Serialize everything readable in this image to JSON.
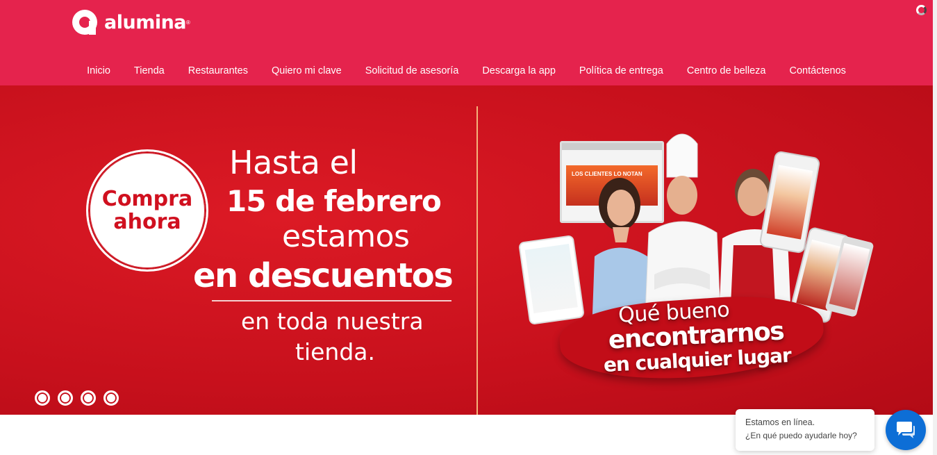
{
  "brand": {
    "name": "alumina",
    "mark": "®",
    "color": "#e5234d"
  },
  "nav": {
    "items": [
      {
        "label": "Inicio"
      },
      {
        "label": "Tienda"
      },
      {
        "label": "Restaurantes"
      },
      {
        "label": "Quiero mi clave"
      },
      {
        "label": "Solicitud de asesoría"
      },
      {
        "label": "Descarga la app"
      },
      {
        "label": "Política de entrega"
      },
      {
        "label": "Centro de belleza"
      },
      {
        "label": "Contáctenos"
      }
    ]
  },
  "hero": {
    "badge": {
      "line1": "Compra",
      "line2": "ahora"
    },
    "headline": {
      "line1": "Hasta el",
      "line2": "15 de febrero",
      "line3": "estamos",
      "line4": "en descuentos",
      "line5": "en toda nuestra",
      "line6": "tienda."
    },
    "tagline": {
      "line1": "Qué bueno",
      "line2": "encontrarnos",
      "line3": "en cualquier lugar"
    },
    "laptop_banner": "LOS CLIENTES LO NOTAN",
    "slides": 4,
    "colors": {
      "background": "#c7101c",
      "accent": "#f4b37a"
    }
  },
  "chat": {
    "status": "Estamos en línea.",
    "prompt": "¿En qué puedo ayudarle hoy?",
    "button_color": "#0d6ed6"
  }
}
